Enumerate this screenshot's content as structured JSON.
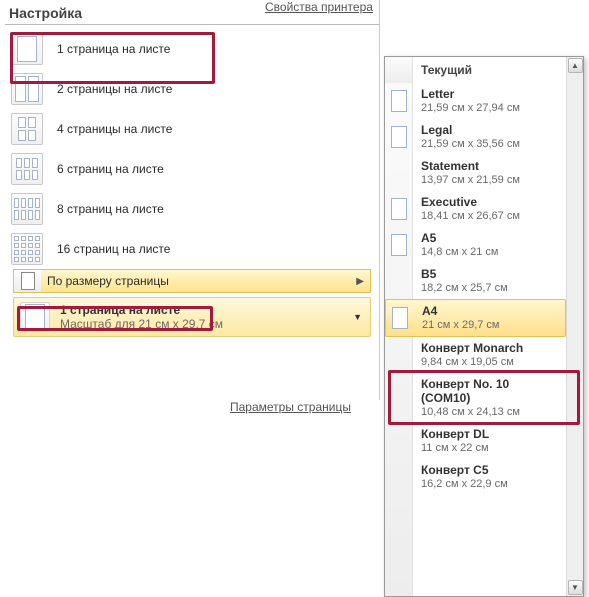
{
  "top_link": "Свойства принтера",
  "header": "Настройка",
  "options": [
    {
      "label": "1 страница на листе"
    },
    {
      "label": "2 страницы на листе"
    },
    {
      "label": "4 страницы на листе"
    },
    {
      "label": "6 страниц на листе"
    },
    {
      "label": "8 страниц на листе"
    },
    {
      "label": "16 страниц на листе"
    }
  ],
  "submenu_label": "По размеру страницы",
  "selected": {
    "title": "1 страница на листе",
    "subtitle": "Масштаб для 21 см x 29,7 см"
  },
  "page_settings_link": "Параметры страницы",
  "flyout": {
    "header": "Текущий",
    "items": [
      {
        "name": "Letter",
        "dim": "21,59 см x 27,94 см",
        "sheet": true
      },
      {
        "name": "Legal",
        "dim": "21,59 см x 35,56 см",
        "sheet": true
      },
      {
        "name": "Statement",
        "dim": "13,97 см x 21,59 см",
        "sheet": false
      },
      {
        "name": "Executive",
        "dim": "18,41 см x 26,67 см",
        "sheet": true
      },
      {
        "name": "A5",
        "dim": "14,8 см x 21 см",
        "sheet": true
      },
      {
        "name": "B5",
        "dim": "18,2 см x 25,7 см",
        "sheet": false
      },
      {
        "name": "A4",
        "dim": "21 см x 29,7 см",
        "sheet": true,
        "selected": true
      },
      {
        "name": "Конверт Monarch",
        "dim": "9,84 см x 19,05 см",
        "sheet": false
      },
      {
        "name": "Конверт No. 10 (COM10)",
        "dim": "10,48 см x 24,13 см",
        "sheet": false
      },
      {
        "name": "Конверт DL",
        "dim": "11 см x 22 см",
        "sheet": false
      },
      {
        "name": "Конверт C5",
        "dim": "16,2 см x 22,9 см",
        "sheet": false
      }
    ]
  }
}
